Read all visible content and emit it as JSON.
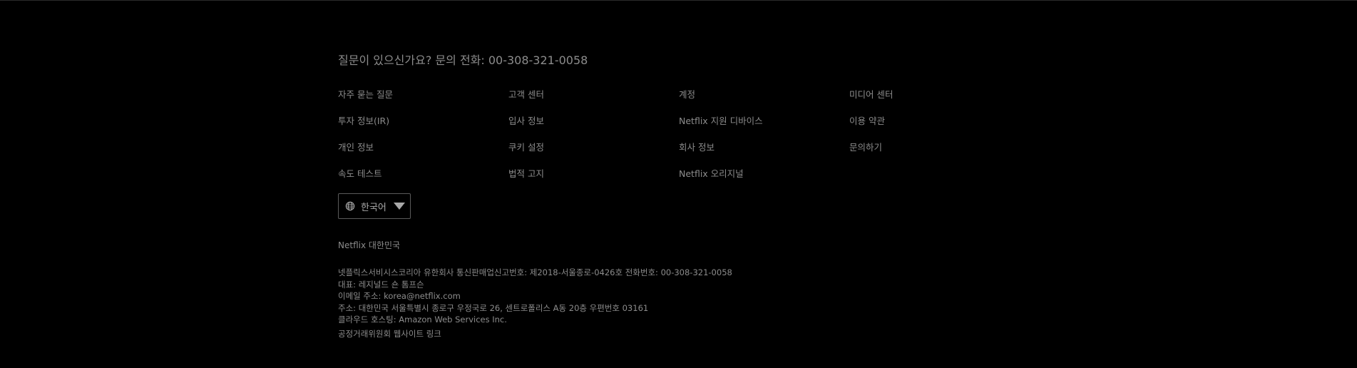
{
  "footer": {
    "question": "질문이 있으신가요? 문의 전화: 00-308-321-0058",
    "links": [
      "자주 묻는 질문",
      "고객 센터",
      "계정",
      "미디어 센터",
      "투자 정보(IR)",
      "입사 정보",
      "Netflix 지원 디바이스",
      "이용 약관",
      "개인 정보",
      "쿠키 설정",
      "회사 정보",
      "문의하기",
      "속도 테스트",
      "법적 고지",
      "Netflix 오리지널"
    ],
    "language": {
      "selected": "한국어",
      "icon": "globe-icon",
      "caret": "caret-down-icon"
    },
    "country": "Netflix 대한민국",
    "legal": [
      "넷플릭스서비시스코리아 유한회사 통신판매업신고번호: 제2018-서울종로-0426호 전화번호: 00-308-321-0058",
      "대표: 레지널드 숀 톰프슨",
      "이메일 주소: korea@netflix.com",
      "주소: 대한민국 서울특별시 종로구 우정국로 26, 센트로폴리스 A동 20층 우편번호 03161",
      "클라우드 호스팅: Amazon Web Services Inc."
    ],
    "ftc_link": "공정거래위원회 웹사이트 링크"
  }
}
